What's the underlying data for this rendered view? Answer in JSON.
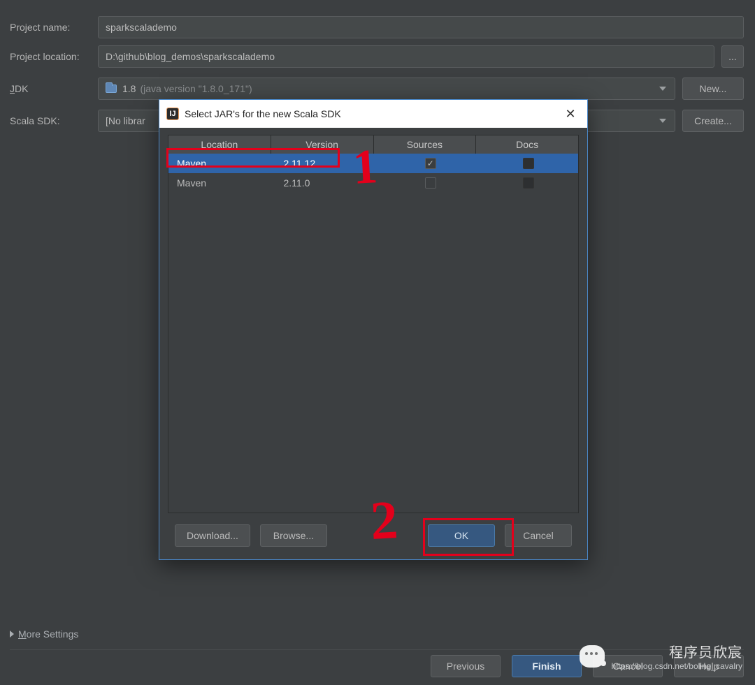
{
  "form": {
    "project_name_label": "Project name:",
    "project_name_value": "sparkscalademo",
    "project_location_label": "Project location:",
    "project_location_value": "D:\\github\\blog_demos\\sparkscalademo",
    "jdk_label": "JDK:",
    "jdk_value": "1.8",
    "jdk_hint": "(java version \"1.8.0_171\")",
    "scala_sdk_label": "Scala SDK:",
    "scala_sdk_value": "[No librar",
    "new_button": "New...",
    "create_button": "Create...",
    "browse_btn": "..."
  },
  "dialog": {
    "title": "Select JAR's for the new Scala SDK",
    "close_symbol": "✕",
    "headers": {
      "location": "Location",
      "version": "Version",
      "sources": "Sources",
      "docs": "Docs"
    },
    "rows": [
      {
        "location": "Maven",
        "version": "2.11.12",
        "sources_checked": true,
        "docs_checked": false,
        "selected": true
      },
      {
        "location": "Maven",
        "version": "2.11.0",
        "sources_checked": false,
        "docs_checked": false,
        "selected": false
      }
    ],
    "buttons": {
      "download": "Download...",
      "browse": "Browse...",
      "ok": "OK",
      "cancel": "Cancel"
    }
  },
  "more_settings": "More Settings",
  "bottom": {
    "previous": "Previous",
    "finish": "Finish",
    "cancel": "Cancel",
    "help": "Help"
  },
  "annotations": {
    "n1": "1",
    "n2": "2"
  },
  "watermark": {
    "cn": "程序员欣宸",
    "url": "https://blog.csdn.net/boling_cavalry"
  }
}
